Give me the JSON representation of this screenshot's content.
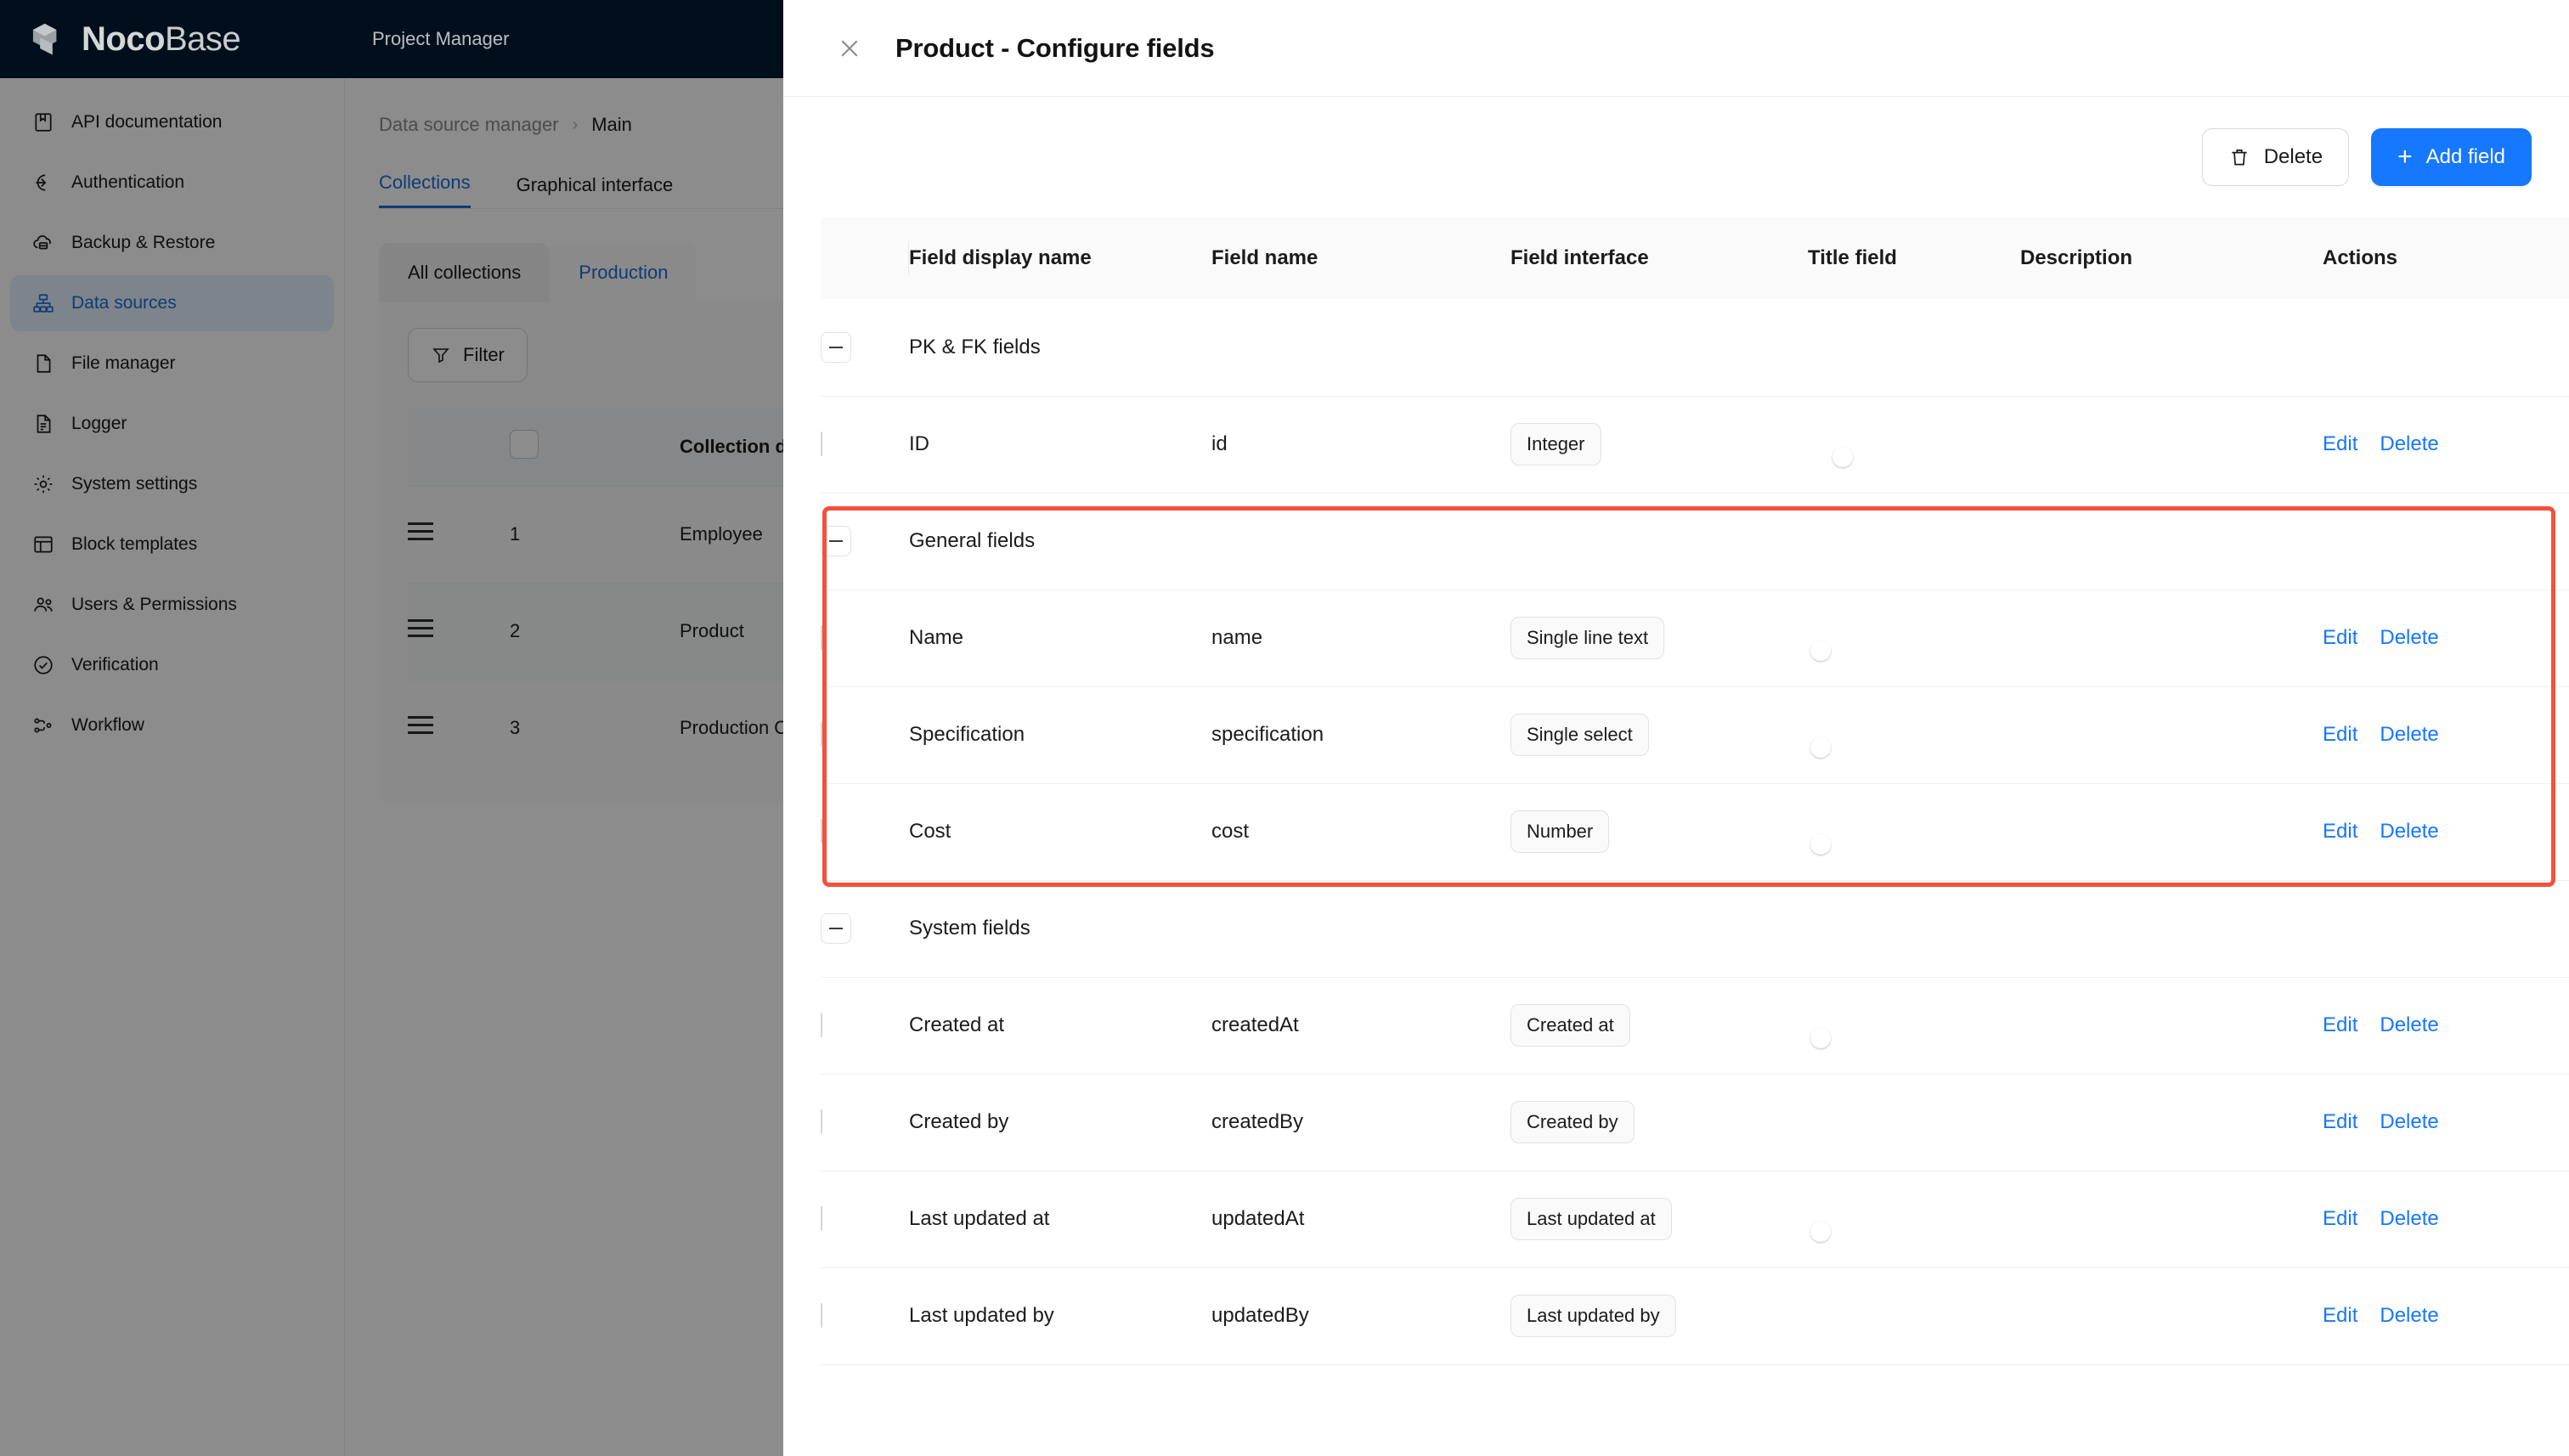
{
  "app": {
    "brand_primary": "Noco",
    "brand_secondary": "Base",
    "workspace_title": "Project Manager",
    "accent_color": "#1677ff",
    "link_color": "#1677ff",
    "highlight_color": "#f4503c"
  },
  "sidebar": {
    "items": [
      {
        "label": "API documentation",
        "icon": "book-icon",
        "active": false
      },
      {
        "label": "Authentication",
        "icon": "login-icon",
        "active": false
      },
      {
        "label": "Backup & Restore",
        "icon": "cloud-server-icon",
        "active": false
      },
      {
        "label": "Data sources",
        "icon": "data-source-icon",
        "active": true
      },
      {
        "label": "File manager",
        "icon": "file-icon",
        "active": false
      },
      {
        "label": "Logger",
        "icon": "log-file-icon",
        "active": false
      },
      {
        "label": "System settings",
        "icon": "gear-icon",
        "active": false
      },
      {
        "label": "Block templates",
        "icon": "template-icon",
        "active": false
      },
      {
        "label": "Users & Permissions",
        "icon": "users-icon",
        "active": false
      },
      {
        "label": "Verification",
        "icon": "check-circle-icon",
        "active": false
      },
      {
        "label": "Workflow",
        "icon": "workflow-icon",
        "active": false
      }
    ]
  },
  "background_page": {
    "breadcrumb": {
      "root": "Data source manager",
      "separator": "›",
      "current": "Main"
    },
    "tabs": [
      {
        "label": "Collections",
        "selected": true
      },
      {
        "label": "Graphical interface",
        "selected": false
      }
    ],
    "segments": [
      {
        "label": "All collections",
        "selected": false
      },
      {
        "label": "Production",
        "selected": true
      }
    ],
    "filter_button": "Filter",
    "table": {
      "headers": [
        "",
        "",
        "",
        "Collection display"
      ],
      "rows": [
        {
          "index": "1",
          "name": "Employee"
        },
        {
          "index": "2",
          "name": "Product"
        },
        {
          "index": "3",
          "name": "Production Order"
        }
      ]
    }
  },
  "modal": {
    "title": "Product - Configure fields",
    "close_icon": "close-icon",
    "toolbar": {
      "delete_label": "Delete",
      "delete_icon": "trash-icon",
      "add_field_label": "Add field",
      "add_field_icon": "plus-icon"
    },
    "table": {
      "columns": [
        "Field display name",
        "Field name",
        "Field interface",
        "Title field",
        "Description",
        "Actions"
      ],
      "groups": [
        {
          "group_label": "PK & FK fields",
          "collapsed": false,
          "highlighted": false,
          "rows": [
            {
              "display_name": "ID",
              "field_name": "id",
              "interface": "Integer",
              "title_field": true,
              "title_field_visible": true,
              "description": "",
              "edit": "Edit",
              "delete": "Delete"
            }
          ]
        },
        {
          "group_label": "General fields",
          "collapsed": false,
          "highlighted": true,
          "rows": [
            {
              "display_name": "Name",
              "field_name": "name",
              "interface": "Single line text",
              "title_field": false,
              "title_field_visible": true,
              "description": "",
              "edit": "Edit",
              "delete": "Delete"
            },
            {
              "display_name": "Specification",
              "field_name": "specification",
              "interface": "Single select",
              "title_field": false,
              "title_field_visible": true,
              "description": "",
              "edit": "Edit",
              "delete": "Delete"
            },
            {
              "display_name": "Cost",
              "field_name": "cost",
              "interface": "Number",
              "title_field": false,
              "title_field_visible": true,
              "description": "",
              "edit": "Edit",
              "delete": "Delete"
            }
          ]
        },
        {
          "group_label": "System fields",
          "collapsed": false,
          "highlighted": false,
          "rows": [
            {
              "display_name": "Created at",
              "field_name": "createdAt",
              "interface": "Created at",
              "title_field": false,
              "title_field_visible": true,
              "description": "",
              "edit": "Edit",
              "delete": "Delete"
            },
            {
              "display_name": "Created by",
              "field_name": "createdBy",
              "interface": "Created by",
              "title_field": false,
              "title_field_visible": false,
              "description": "",
              "edit": "Edit",
              "delete": "Delete"
            },
            {
              "display_name": "Last updated at",
              "field_name": "updatedAt",
              "interface": "Last updated at",
              "title_field": false,
              "title_field_visible": true,
              "description": "",
              "edit": "Edit",
              "delete": "Delete"
            },
            {
              "display_name": "Last updated by",
              "field_name": "updatedBy",
              "interface": "Last updated by",
              "title_field": false,
              "title_field_visible": false,
              "description": "",
              "edit": "Edit",
              "delete": "Delete"
            }
          ]
        }
      ]
    }
  }
}
